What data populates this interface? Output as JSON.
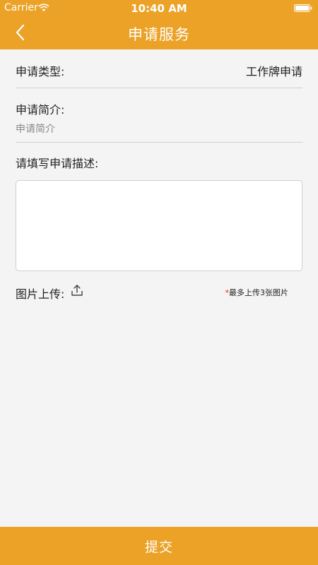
{
  "status_bar": {
    "carrier": "Carrier",
    "time": "10:40 AM",
    "wifi_icon": "wifi-icon",
    "battery_icon": "battery-icon"
  },
  "nav": {
    "title": "申请服务",
    "back_icon": "chevron-left-icon"
  },
  "form": {
    "type_label": "申请类型:",
    "type_value": "工作牌申请",
    "intro_label": "申请简介:",
    "intro_placeholder": "申请简介",
    "intro_value": "",
    "description_label": "请填写申请描述:",
    "description_value": "",
    "upload_label": "图片上传:",
    "upload_icon": "upload-icon",
    "upload_required_mark": "*",
    "upload_note": "最多上传3张图片"
  },
  "footer": {
    "submit_label": "提交"
  },
  "colors": {
    "accent": "#eba227",
    "background": "#f4f4f4",
    "divider": "#cfcfcf",
    "required": "#e02020"
  }
}
